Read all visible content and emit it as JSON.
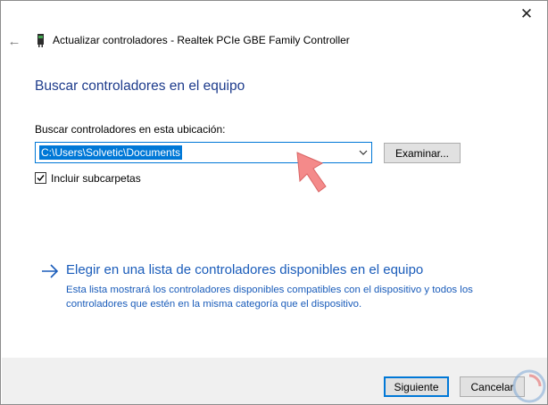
{
  "window": {
    "title": "Actualizar controladores - Realtek PCIe GBE Family Controller",
    "close_glyph": "✕",
    "back_glyph": "←"
  },
  "main": {
    "heading": "Buscar controladores en el equipo",
    "location_label": "Buscar controladores en esta ubicación:",
    "path_value": "C:\\Users\\Solvetic\\Documents",
    "browse_label": "Examinar...",
    "include_subfolders_label": "Incluir subcarpetas",
    "include_subfolders_checked": true,
    "pick_link": "Elegir en una lista de controladores disponibles en el equipo",
    "pick_description": "Esta lista mostrará los controladores disponibles compatibles con el dispositivo y todos los controladores que estén en la misma categoría que el dispositivo."
  },
  "footer": {
    "next_label": "Siguiente",
    "cancel_label": "Cancelar"
  },
  "icons": {
    "title_icon": "network-adapter-icon",
    "pointer": "red-arrow-annotation-icon",
    "pick_arrow": "right-arrow-icon",
    "watermark": "logo-watermark-icon"
  },
  "colors": {
    "heading": "#1e3c8c",
    "link": "#1a5cba",
    "selection": "#0078d7",
    "annotation_arrow": "#f08080"
  }
}
